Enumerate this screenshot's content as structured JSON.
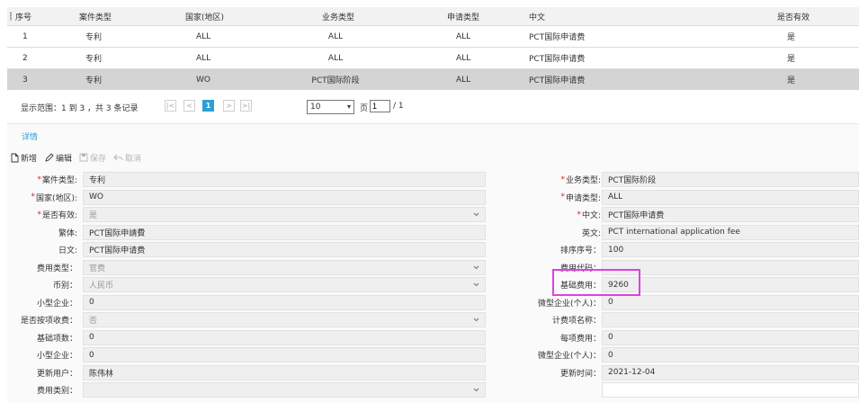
{
  "grid": {
    "columns": [
      "序号",
      "案件类型",
      "国家(地区)",
      "业务类型",
      "申请类型",
      "中文",
      "是否有效"
    ],
    "rows": [
      {
        "no": "1",
        "case_type": "专利",
        "country": "ALL",
        "business_type": "ALL",
        "apply_type": "ALL",
        "chinese": "PCT国际申请费",
        "valid": "是"
      },
      {
        "no": "2",
        "case_type": "专利",
        "country": "ALL",
        "business_type": "ALL",
        "apply_type": "ALL",
        "chinese": "PCT国际申请费",
        "valid": "是"
      },
      {
        "no": "3",
        "case_type": "专利",
        "country": "WO",
        "business_type": "PCT国际阶段",
        "apply_type": "ALL",
        "chinese": "PCT国际申请费",
        "valid": "是"
      }
    ]
  },
  "pager": {
    "range_text": "显示范围：1 到 3 ，共 3 条记录",
    "first": "|<",
    "prev": "<",
    "current": "1",
    "next": ">",
    "last": ">|",
    "page_size": "10",
    "page_label": "页",
    "page_value": "1",
    "total_pages": "/ 1"
  },
  "detail": {
    "tab": "详情",
    "toolbar": {
      "new": "新增",
      "edit": "编辑",
      "save": "保存",
      "cancel": "取消"
    },
    "left": [
      {
        "label": "案件类型:",
        "required": true,
        "value": "专利",
        "select": false,
        "muted": false
      },
      {
        "label": "国家(地区):",
        "required": true,
        "value": "WO",
        "select": false,
        "muted": false
      },
      {
        "label": "是否有效:",
        "required": true,
        "value": "是",
        "select": true,
        "muted": true
      },
      {
        "label": "繁体:",
        "required": false,
        "value": "PCT国际申請費",
        "select": false,
        "muted": false
      },
      {
        "label": "日文:",
        "required": false,
        "value": "PCT国际申请费",
        "select": false,
        "muted": false
      },
      {
        "label": "费用类型：",
        "required": false,
        "value": "官费",
        "select": true,
        "muted": true
      },
      {
        "label": "币别：",
        "required": false,
        "value": "人民币",
        "select": true,
        "muted": true
      },
      {
        "label": "小型企业：",
        "required": false,
        "value": "0",
        "select": false,
        "muted": false
      },
      {
        "label": "是否按项收费：",
        "required": false,
        "value": "否",
        "select": true,
        "muted": true
      },
      {
        "label": "基础项数：",
        "required": false,
        "value": "0",
        "select": false,
        "muted": false
      },
      {
        "label": "小型企业：",
        "required": false,
        "value": "0",
        "select": false,
        "muted": false
      },
      {
        "label": "更新用户：",
        "required": false,
        "value": "陈伟林",
        "select": false,
        "muted": false
      },
      {
        "label": "费用类别：",
        "required": false,
        "value": "",
        "select": true,
        "muted": true
      }
    ],
    "right": [
      {
        "label": "业务类型:",
        "required": true,
        "value": "PCT国际阶段",
        "white": false
      },
      {
        "label": "申请类型:",
        "required": true,
        "value": "ALL",
        "white": false
      },
      {
        "label": "中文:",
        "required": true,
        "value": "PCT国际申请费",
        "white": false
      },
      {
        "label": "英文:",
        "required": false,
        "value": "PCT international application fee",
        "white": false
      },
      {
        "label": "排序序号：",
        "required": false,
        "value": "100",
        "white": false
      },
      {
        "label": "费用代码：",
        "required": false,
        "value": "",
        "white": false
      },
      {
        "label": "基础费用：",
        "required": false,
        "value": "9260",
        "white": false
      },
      {
        "label": "微型企业(个人)：",
        "required": false,
        "value": "0",
        "white": false
      },
      {
        "label": "计费项名称：",
        "required": false,
        "value": "",
        "white": false
      },
      {
        "label": "每项费用：",
        "required": false,
        "value": "0",
        "white": false
      },
      {
        "label": "微型企业(个人)：",
        "required": false,
        "value": "0",
        "white": false
      },
      {
        "label": "更新时间：",
        "required": false,
        "value": "2021-12-04",
        "white": false
      },
      {
        "label": "",
        "required": false,
        "value": "",
        "white": true
      }
    ]
  },
  "colors": {
    "accent": "#2b9fd8",
    "highlight": "#e040e0",
    "required": "#e02020",
    "selected_row": "#d4d4d4"
  }
}
